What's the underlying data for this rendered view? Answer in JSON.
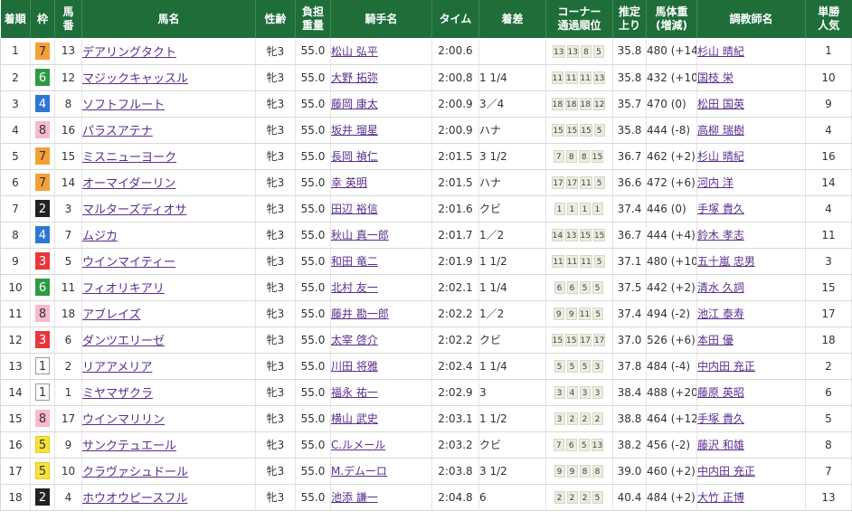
{
  "headers": {
    "rank": "着順",
    "waku": "枠",
    "umaban": "馬\n番",
    "horse": "馬名",
    "sexage": "性齢",
    "weight": "負担\n重量",
    "jockey": "騎手名",
    "time": "タイム",
    "margin": "着差",
    "corner": "コーナー\n通過順位",
    "last3f": "推定\n上り",
    "bodyweight": "馬体重\n(増減)",
    "trainer": "調教師名",
    "pop": "単勝\n人気"
  },
  "waku_colors": {
    "1": {
      "bg": "#ffffff",
      "fg": "#333333",
      "border": "#999999"
    },
    "2": {
      "bg": "#222222",
      "fg": "#ffffff",
      "border": "#222222"
    },
    "3": {
      "bg": "#e8363a",
      "fg": "#ffffff",
      "border": "#e8363a"
    },
    "4": {
      "bg": "#2d76d6",
      "fg": "#ffffff",
      "border": "#2d76d6"
    },
    "5": {
      "bg": "#f5e23a",
      "fg": "#333333",
      "border": "#e0cc20"
    },
    "6": {
      "bg": "#2e9a45",
      "fg": "#ffffff",
      "border": "#2e9a45"
    },
    "7": {
      "bg": "#f4a038",
      "fg": "#333333",
      "border": "#f4a038"
    },
    "8": {
      "bg": "#f8b9cc",
      "fg": "#333333",
      "border": "#f8b9cc"
    }
  },
  "rows": [
    {
      "rank": "1",
      "waku": "7",
      "umaban": "13",
      "horse": "デアリングタクト",
      "sexage": "牝3",
      "weight": "55.0",
      "jockey": "松山 弘平",
      "time": "2:00.6",
      "margin": "",
      "corner": [
        "13",
        "13",
        "8",
        "5"
      ],
      "last3f": "35.8",
      "bodyweight": "480 (+14)",
      "trainer": "杉山 晴紀",
      "pop": "1"
    },
    {
      "rank": "2",
      "waku": "6",
      "umaban": "12",
      "horse": "マジックキャッスル",
      "sexage": "牝3",
      "weight": "55.0",
      "jockey": "大野 拓弥",
      "time": "2:00.8",
      "margin": "1 1/4",
      "corner": [
        "11",
        "11",
        "11",
        "13"
      ],
      "last3f": "35.8",
      "bodyweight": "432 (+10)",
      "trainer": "国枝 栄",
      "pop": "10"
    },
    {
      "rank": "3",
      "waku": "4",
      "umaban": "8",
      "horse": "ソフトフルート",
      "sexage": "牝3",
      "weight": "55.0",
      "jockey": "藤岡 康太",
      "time": "2:00.9",
      "margin": "3／4",
      "corner": [
        "18",
        "18",
        "18",
        "12"
      ],
      "last3f": "35.7",
      "bodyweight": "470 (0)",
      "trainer": "松田 国英",
      "pop": "9"
    },
    {
      "rank": "4",
      "waku": "8",
      "umaban": "16",
      "horse": "パラスアテナ",
      "sexage": "牝3",
      "weight": "55.0",
      "jockey": "坂井 瑠星",
      "time": "2:00.9",
      "margin": "ハナ",
      "corner": [
        "15",
        "15",
        "15",
        "5"
      ],
      "last3f": "35.8",
      "bodyweight": "444 (-8)",
      "trainer": "高柳 瑞樹",
      "pop": "4"
    },
    {
      "rank": "5",
      "waku": "7",
      "umaban": "15",
      "horse": "ミスニューヨーク",
      "sexage": "牝3",
      "weight": "55.0",
      "jockey": "長岡 禎仁",
      "time": "2:01.5",
      "margin": "3 1/2",
      "corner": [
        "7",
        "8",
        "8",
        "15"
      ],
      "last3f": "36.7",
      "bodyweight": "462 (+2)",
      "trainer": "杉山 晴紀",
      "pop": "16"
    },
    {
      "rank": "6",
      "waku": "7",
      "umaban": "14",
      "horse": "オーマイダーリン",
      "sexage": "牝3",
      "weight": "55.0",
      "jockey": "幸 英明",
      "time": "2:01.5",
      "margin": "ハナ",
      "corner": [
        "17",
        "17",
        "11",
        "5"
      ],
      "last3f": "36.6",
      "bodyweight": "472 (+6)",
      "trainer": "河内 洋",
      "pop": "14"
    },
    {
      "rank": "7",
      "waku": "2",
      "umaban": "3",
      "horse": "マルターズディオサ",
      "sexage": "牝3",
      "weight": "55.0",
      "jockey": "田辺 裕信",
      "time": "2:01.6",
      "margin": "クビ",
      "corner": [
        "1",
        "1",
        "1",
        "1"
      ],
      "last3f": "37.4",
      "bodyweight": "446 (0)",
      "trainer": "手塚 貴久",
      "pop": "4"
    },
    {
      "rank": "8",
      "waku": "4",
      "umaban": "7",
      "horse": "ムジカ",
      "sexage": "牝3",
      "weight": "55.0",
      "jockey": "秋山 真一郎",
      "time": "2:01.7",
      "margin": "1／2",
      "corner": [
        "14",
        "13",
        "15",
        "15"
      ],
      "last3f": "36.7",
      "bodyweight": "444 (+4)",
      "trainer": "鈴木 孝志",
      "pop": "11"
    },
    {
      "rank": "9",
      "waku": "3",
      "umaban": "5",
      "horse": "ウインマイティー",
      "sexage": "牝3",
      "weight": "55.0",
      "jockey": "和田 竜二",
      "time": "2:01.9",
      "margin": "1 1/2",
      "corner": [
        "11",
        "11",
        "11",
        "5"
      ],
      "last3f": "37.1",
      "bodyweight": "480 (+10)",
      "trainer": "五十嵐 忠男",
      "pop": "3"
    },
    {
      "rank": "10",
      "waku": "6",
      "umaban": "11",
      "horse": "フィオリキアリ",
      "sexage": "牝3",
      "weight": "55.0",
      "jockey": "北村 友一",
      "time": "2:02.1",
      "margin": "1 1/4",
      "corner": [
        "6",
        "6",
        "5",
        "5"
      ],
      "last3f": "37.5",
      "bodyweight": "442 (+2)",
      "trainer": "清水 久詞",
      "pop": "15"
    },
    {
      "rank": "11",
      "waku": "8",
      "umaban": "18",
      "horse": "アブレイズ",
      "sexage": "牝3",
      "weight": "55.0",
      "jockey": "藤井 勘一郎",
      "time": "2:02.2",
      "margin": "1／2",
      "corner": [
        "9",
        "9",
        "11",
        "5"
      ],
      "last3f": "37.4",
      "bodyweight": "494 (-2)",
      "trainer": "池江 泰寿",
      "pop": "17"
    },
    {
      "rank": "12",
      "waku": "3",
      "umaban": "6",
      "horse": "ダンツエリーゼ",
      "sexage": "牝3",
      "weight": "55.0",
      "jockey": "太宰 啓介",
      "time": "2:02.2",
      "margin": "クビ",
      "corner": [
        "15",
        "15",
        "17",
        "17"
      ],
      "last3f": "37.0",
      "bodyweight": "526 (+6)",
      "trainer": "本田 優",
      "pop": "18"
    },
    {
      "rank": "13",
      "waku": "1",
      "umaban": "2",
      "horse": "リアアメリア",
      "sexage": "牝3",
      "weight": "55.0",
      "jockey": "川田 将雅",
      "time": "2:02.4",
      "margin": "1 1/4",
      "corner": [
        "5",
        "5",
        "5",
        "3"
      ],
      "last3f": "37.8",
      "bodyweight": "484 (-4)",
      "trainer": "中内田 充正",
      "pop": "2"
    },
    {
      "rank": "14",
      "waku": "1",
      "umaban": "1",
      "horse": "ミヤマザクラ",
      "sexage": "牝3",
      "weight": "55.0",
      "jockey": "福永 祐一",
      "time": "2:02.9",
      "margin": "3",
      "corner": [
        "3",
        "4",
        "3",
        "3"
      ],
      "last3f": "38.4",
      "bodyweight": "488 (+20)",
      "trainer": "藤原 英昭",
      "pop": "6"
    },
    {
      "rank": "15",
      "waku": "8",
      "umaban": "17",
      "horse": "ウインマリリン",
      "sexage": "牝3",
      "weight": "55.0",
      "jockey": "横山 武史",
      "time": "2:03.1",
      "margin": "1 1/2",
      "corner": [
        "3",
        "2",
        "2",
        "2"
      ],
      "last3f": "38.8",
      "bodyweight": "464 (+12)",
      "trainer": "手塚 貴久",
      "pop": "5"
    },
    {
      "rank": "16",
      "waku": "5",
      "umaban": "9",
      "horse": "サンクテュエール",
      "sexage": "牝3",
      "weight": "55.0",
      "jockey": "C.ルメール",
      "time": "2:03.2",
      "margin": "クビ",
      "corner": [
        "7",
        "6",
        "5",
        "13"
      ],
      "last3f": "38.2",
      "bodyweight": "456 (-2)",
      "trainer": "藤沢 和雄",
      "pop": "8"
    },
    {
      "rank": "17",
      "waku": "5",
      "umaban": "10",
      "horse": "クラヴァシュドール",
      "sexage": "牝3",
      "weight": "55.0",
      "jockey": "M.デムーロ",
      "time": "2:03.8",
      "margin": "3 1/2",
      "corner": [
        "9",
        "9",
        "8",
        "8"
      ],
      "last3f": "39.0",
      "bodyweight": "460 (+2)",
      "trainer": "中内田 充正",
      "pop": "7"
    },
    {
      "rank": "18",
      "waku": "2",
      "umaban": "4",
      "horse": "ホウオウピースフル",
      "sexage": "牝3",
      "weight": "55.0",
      "jockey": "池添 謙一",
      "time": "2:04.8",
      "margin": "6",
      "corner": [
        "2",
        "2",
        "2",
        "5"
      ],
      "last3f": "40.4",
      "bodyweight": "484 (+2)",
      "trainer": "大竹 正博",
      "pop": "13"
    }
  ]
}
